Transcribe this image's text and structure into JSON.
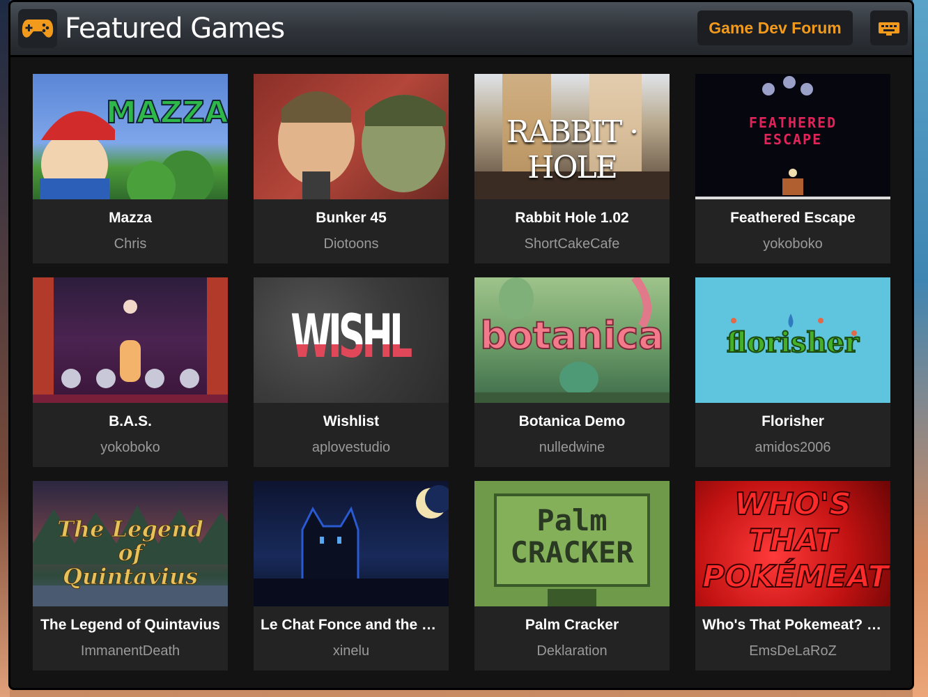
{
  "header": {
    "title": "Featured Games",
    "forum_button": "Game Dev Forum",
    "logo_icon": "gamepad-icon",
    "menu_icon": "keyboard-icon",
    "accent_color": "#f29a1c"
  },
  "games": [
    {
      "name": "Mazza",
      "author": "Chris",
      "thumb_text": "MAZZA"
    },
    {
      "name": "Bunker 45",
      "author": "Diotoons",
      "thumb_text": ""
    },
    {
      "name": "Rabbit Hole 1.02",
      "author": "ShortCakeCafe",
      "thumb_text": "RABBIT · HOLE"
    },
    {
      "name": "Feathered Escape",
      "author": "yokoboko",
      "thumb_text": "FEATHERED ESCAPE"
    },
    {
      "name": "B.A.S.",
      "author": "yokoboko",
      "thumb_text": ""
    },
    {
      "name": "Wishlist",
      "author": "aplovestudio",
      "thumb_text": "WISHLIST"
    },
    {
      "name": "Botanica Demo",
      "author": "nulledwine",
      "thumb_text": "botanica"
    },
    {
      "name": "Florisher",
      "author": "amidos2006",
      "thumb_text": "florisher"
    },
    {
      "name": "The Legend of Quintavius",
      "author": "ImmanentDeath",
      "thumb_text": "The Legend of Quintavius"
    },
    {
      "name": "Le Chat Fonce and the S…",
      "author": "xinelu",
      "thumb_text": ""
    },
    {
      "name": "Palm Cracker",
      "author": "Deklaration",
      "thumb_text": "Palm CRACKER"
    },
    {
      "name": "Who's That Pokemeat? (…",
      "author": "EmsDeLaRoZ",
      "thumb_text": "WHO'S THAT POKÉMEAT"
    }
  ]
}
